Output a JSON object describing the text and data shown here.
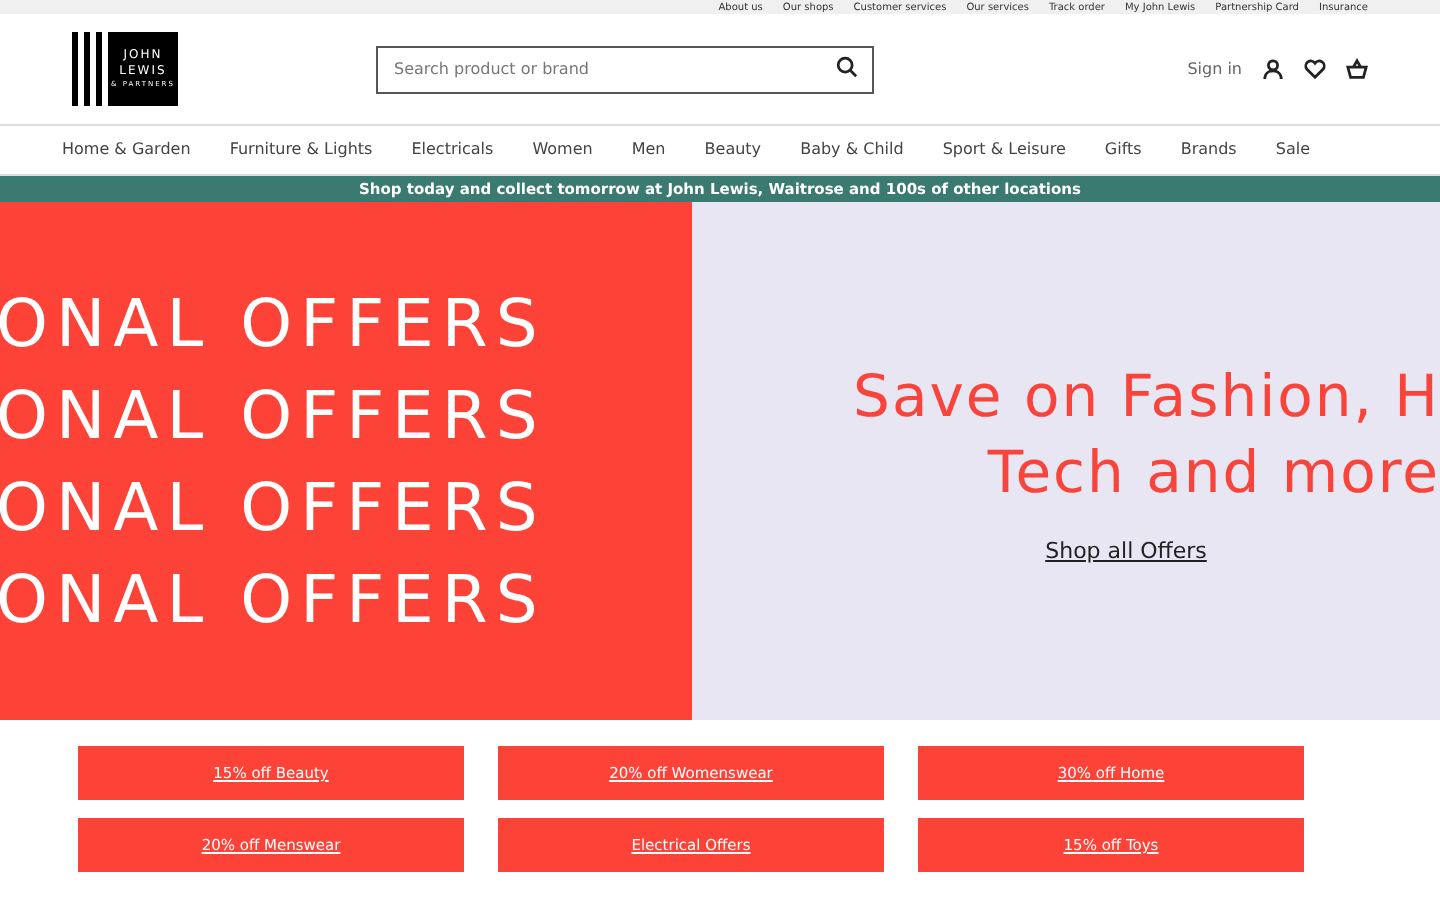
{
  "top_links": [
    "About us",
    "Our shops",
    "Customer services",
    "Our services",
    "Track order",
    "My John Lewis",
    "Partnership Card",
    "Insurance"
  ],
  "logo": {
    "lines": [
      "JOHN",
      "LEWIS",
      "& PARTNERS"
    ]
  },
  "search": {
    "placeholder": "Search product or brand"
  },
  "account": {
    "sign_in": "Sign in"
  },
  "nav": [
    "Home & Garden",
    "Furniture & Lights",
    "Electricals",
    "Women",
    "Men",
    "Beauty",
    "Baby & Child",
    "Sport & Leisure",
    "Gifts",
    "Brands",
    "Sale"
  ],
  "banner": "Shop today and collect tomorrow at John Lewis, Waitrose and 100s of other locations",
  "hero": {
    "repeated": [
      "ONAL OFFERS",
      "ONAL OFFERS",
      "ONAL OFFERS",
      "ONAL OFFERS"
    ],
    "headline": [
      "Save on Fashion, H",
      "Tech and more"
    ],
    "link": "Shop all Offers"
  },
  "offers": [
    "15% off Beauty",
    "20% off Womenswear",
    "30% off Home",
    "20% off Menswear",
    "Electrical Offers",
    "15% off Toys"
  ]
}
